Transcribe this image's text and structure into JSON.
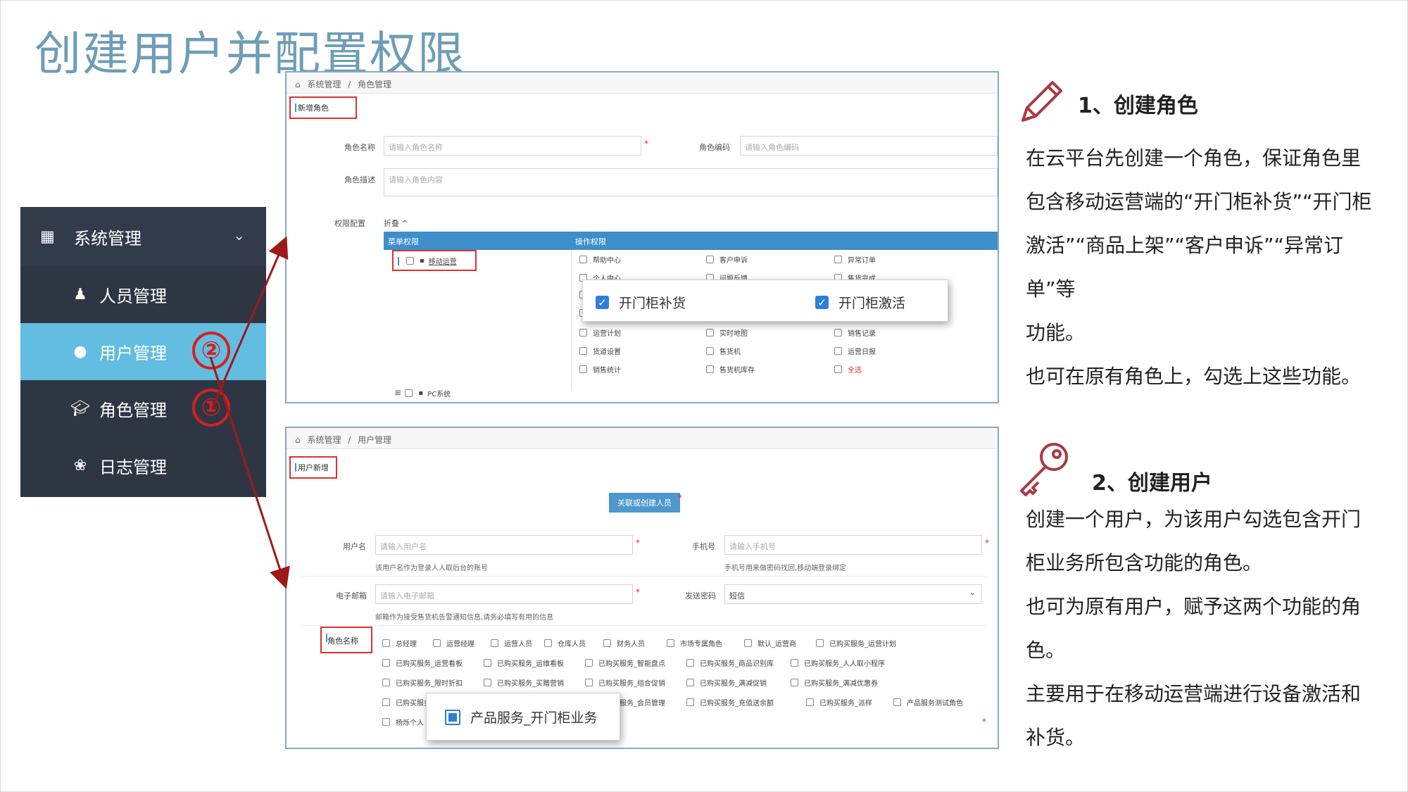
{
  "title": "创建用户并配置权限",
  "sidebar": {
    "header": {
      "label": "系统管理",
      "icon": "grid-icon"
    },
    "items": [
      {
        "label": "人员管理",
        "icon": "person-icon",
        "active": false
      },
      {
        "label": "用户管理",
        "icon": "user-icon",
        "active": true
      },
      {
        "label": "角色管理",
        "icon": "graduation-cap-icon",
        "active": false
      },
      {
        "label": "日志管理",
        "icon": "paw-icon",
        "active": false
      }
    ],
    "markers": [
      "②",
      "①"
    ]
  },
  "role_panel": {
    "breadcrumb": [
      "系统管理",
      "/",
      "角色管理"
    ],
    "tab": "新增角色",
    "fields": {
      "name_label": "角色名称",
      "name_placeholder": "请输入角色名称",
      "code_label": "角色编码",
      "code_placeholder": "请输入角色编码",
      "desc_label": "角色描述",
      "desc_placeholder": "请输入角色内容",
      "perm_label": "权限配置",
      "collapse": "折叠 ^",
      "required_mark": "*"
    },
    "table_headers": {
      "menu": "菜单权限",
      "ops": "操作权限"
    },
    "menu_item": "移动运营",
    "pc_item": "PC系统",
    "ops": [
      [
        "帮助中心",
        "客户申诉",
        "异常订单"
      ],
      [
        "个人中心",
        "问题反馈",
        "售货完成"
      ],
      [
        "运营计划",
        "实时地图",
        "销售记录"
      ],
      [
        "货道设置",
        "售货机",
        "运营日报"
      ],
      [
        "销售统计",
        "售货机库存",
        "全选"
      ]
    ],
    "popup": {
      "items": [
        "开门柜补货",
        "开门柜激活"
      ],
      "check": "✓"
    }
  },
  "user_panel": {
    "breadcrumb": [
      "系统管理",
      "/",
      "用户管理"
    ],
    "tab": "用户新增",
    "button": "关联或创建人员",
    "required_mark": "*",
    "fields": {
      "username_label": "用户名",
      "username_placeholder": "请输入用户名",
      "username_hint": "该用户名作为登录人人取后台的账号",
      "phone_label": "手机号",
      "phone_placeholder": "请输入手机号",
      "phone_hint": "手机号用来做密码找回,移动端登录绑定",
      "email_label": "电子邮箱",
      "email_placeholder": "请输入电子邮箱",
      "email_hint": "邮箱作为接受售货机告警通知信息,请务必填写有用的信息",
      "send_label": "发送密码",
      "send_value": "短信",
      "send_arrow": "⌄",
      "role_label": "角色名称"
    },
    "roles": [
      [
        "总经理",
        "运营经理",
        "运营人员",
        "仓库人员",
        "财务人员",
        "市场专属角色",
        "默认_运营商",
        "已购买服务_运营计划"
      ],
      [
        "已购买服务_运营看板",
        "已购买服务_运维看板",
        "已购买服务_智能盘点",
        "已购买服务_商品识别库",
        "已购买服务_人人取小程序"
      ],
      [
        "已购买服务_限时折扣",
        "已购买服务_买赠营销",
        "已购买服务_组合促销",
        "已购买服务_满减促销",
        "已购买服务_满减优惠券"
      ],
      [
        "已购买服务",
        "",
        "已购买服务_会员管理",
        "已购买服务_充值送余额",
        "已购买服务_派样",
        "产品服务测试角色"
      ],
      [
        "杨烁个人"
      ]
    ],
    "popup": {
      "label": "产品服务_开门柜业务"
    }
  },
  "section1": {
    "icon": "pencil-icon",
    "heading": "1、创建角色",
    "lines": [
      "在云平台先创建一个角色，保证角色里",
      "包含移动运营端的“开门柜补货”“开门柜",
      "激活”“商品上架”“客户申诉”“异常订单”等",
      "功能。",
      "也可在原有角色上，勾选上这些功能。"
    ]
  },
  "section2": {
    "icon": "key-icon",
    "heading": "2、创建用户",
    "lines": [
      "创建一个用户，为该用户勾选包含开门",
      "柜业务所包含功能的角色。",
      "也可为原有用户，赋予这两个功能的角",
      "色。",
      "主要用于在移动运营端进行设备激活和",
      "补货。"
    ]
  },
  "colors": {
    "title": "#6e9db6",
    "sidebar": "#2e3644",
    "active": "#62bde0",
    "accent_red": "#e03030",
    "arrow": "#a01818",
    "table_head": "#3d8ec9"
  }
}
